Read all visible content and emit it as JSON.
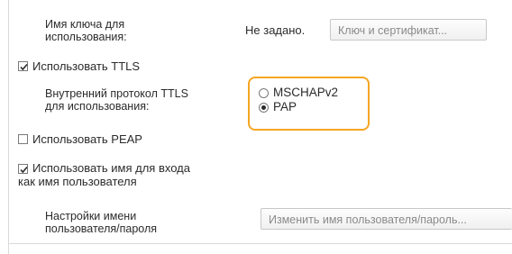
{
  "key_usage": {
    "label": "Имя ключа для использования:",
    "label_line1": "Имя ключа для",
    "label_line2": "использования:",
    "status": "Не задано.",
    "button_label": "Ключ и сертификат..."
  },
  "use_ttls": {
    "label": "Использовать TTLS",
    "checked": true
  },
  "ttls_inner_protocol": {
    "label_line1": "Внутренний протокол TTLS",
    "label_line2": "для использования:",
    "options": [
      {
        "label": "MSCHAPv2",
        "selected": false
      },
      {
        "label": "PAP",
        "selected": true
      }
    ],
    "highlight_color": "#f5a623"
  },
  "use_peap": {
    "label": "Использовать PEAP",
    "checked": false
  },
  "use_login_as_username": {
    "label_line1": "Использовать имя для входа",
    "label_line2": "как имя пользователя",
    "checked": true
  },
  "username_password_settings": {
    "label_line1": "Настройки имени",
    "label_line2": "пользователя/пароля",
    "button_label": "Изменить имя пользователя/пароль..."
  }
}
